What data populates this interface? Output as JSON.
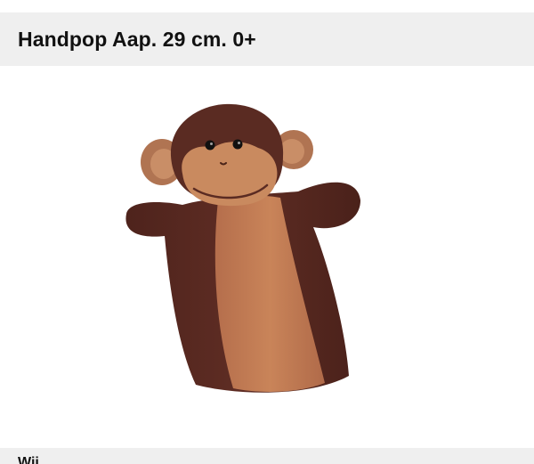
{
  "header": {
    "title": "Handpop Aap. 29 cm. 0+"
  },
  "product_image": {
    "subject": "monkey-hand-puppet",
    "colors": {
      "dark_brown": "#5a2b22",
      "light_brown": "#c47a55",
      "face": "#c98a5f"
    }
  },
  "section": {
    "heading": "Wij"
  }
}
